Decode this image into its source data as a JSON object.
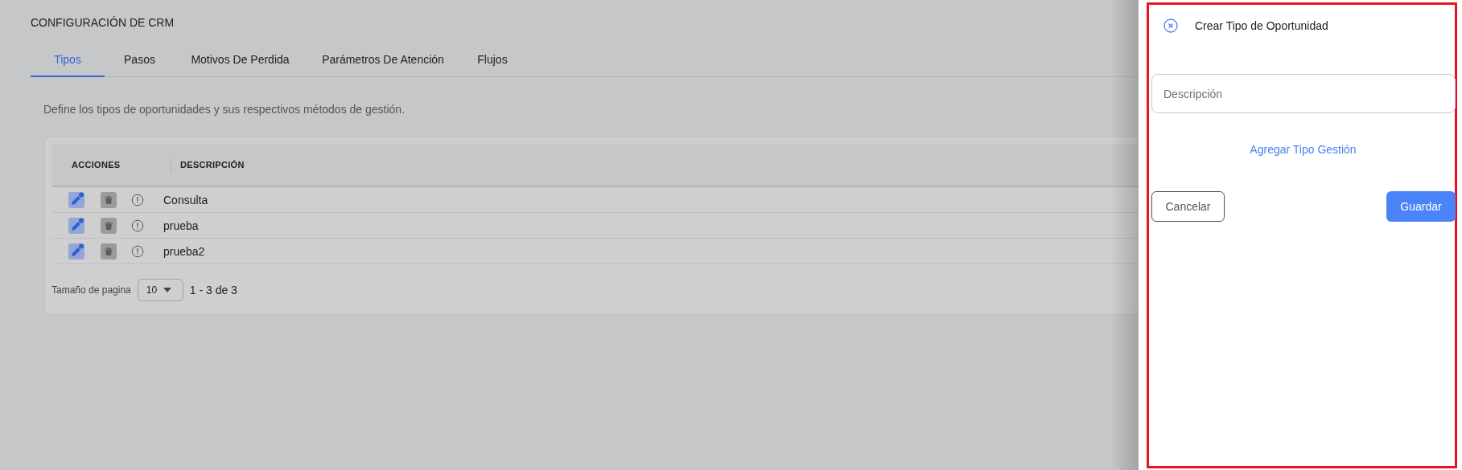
{
  "page": {
    "title": "CONFIGURACIÓN DE CRM"
  },
  "tabs": [
    {
      "label": "Tipos",
      "selected": true
    },
    {
      "label": "Pasos",
      "selected": false
    },
    {
      "label": "Motivos De Perdida",
      "selected": false
    },
    {
      "label": "Parámetros De Atención",
      "selected": false
    },
    {
      "label": "Flujos",
      "selected": false
    }
  ],
  "intro": "Define los tipos de oportunidades y sus respectivos métodos de gestión.",
  "table": {
    "columns": [
      "ACCIONES",
      "DESCRIPCIÓN"
    ],
    "rows": [
      {
        "description": "Consulta"
      },
      {
        "description": "prueba"
      },
      {
        "description": "prueba2"
      }
    ]
  },
  "pagination": {
    "label": "Tamaño de pagina",
    "page_size": "10",
    "range": "1 - 3 de 3"
  },
  "drawer": {
    "title": "Crear Tipo de Oportunidad",
    "field": {
      "placeholder": "Descripción"
    },
    "link": "Agregar Tipo Gestión",
    "cancel": "Cancelar",
    "save": "Guardar"
  }
}
